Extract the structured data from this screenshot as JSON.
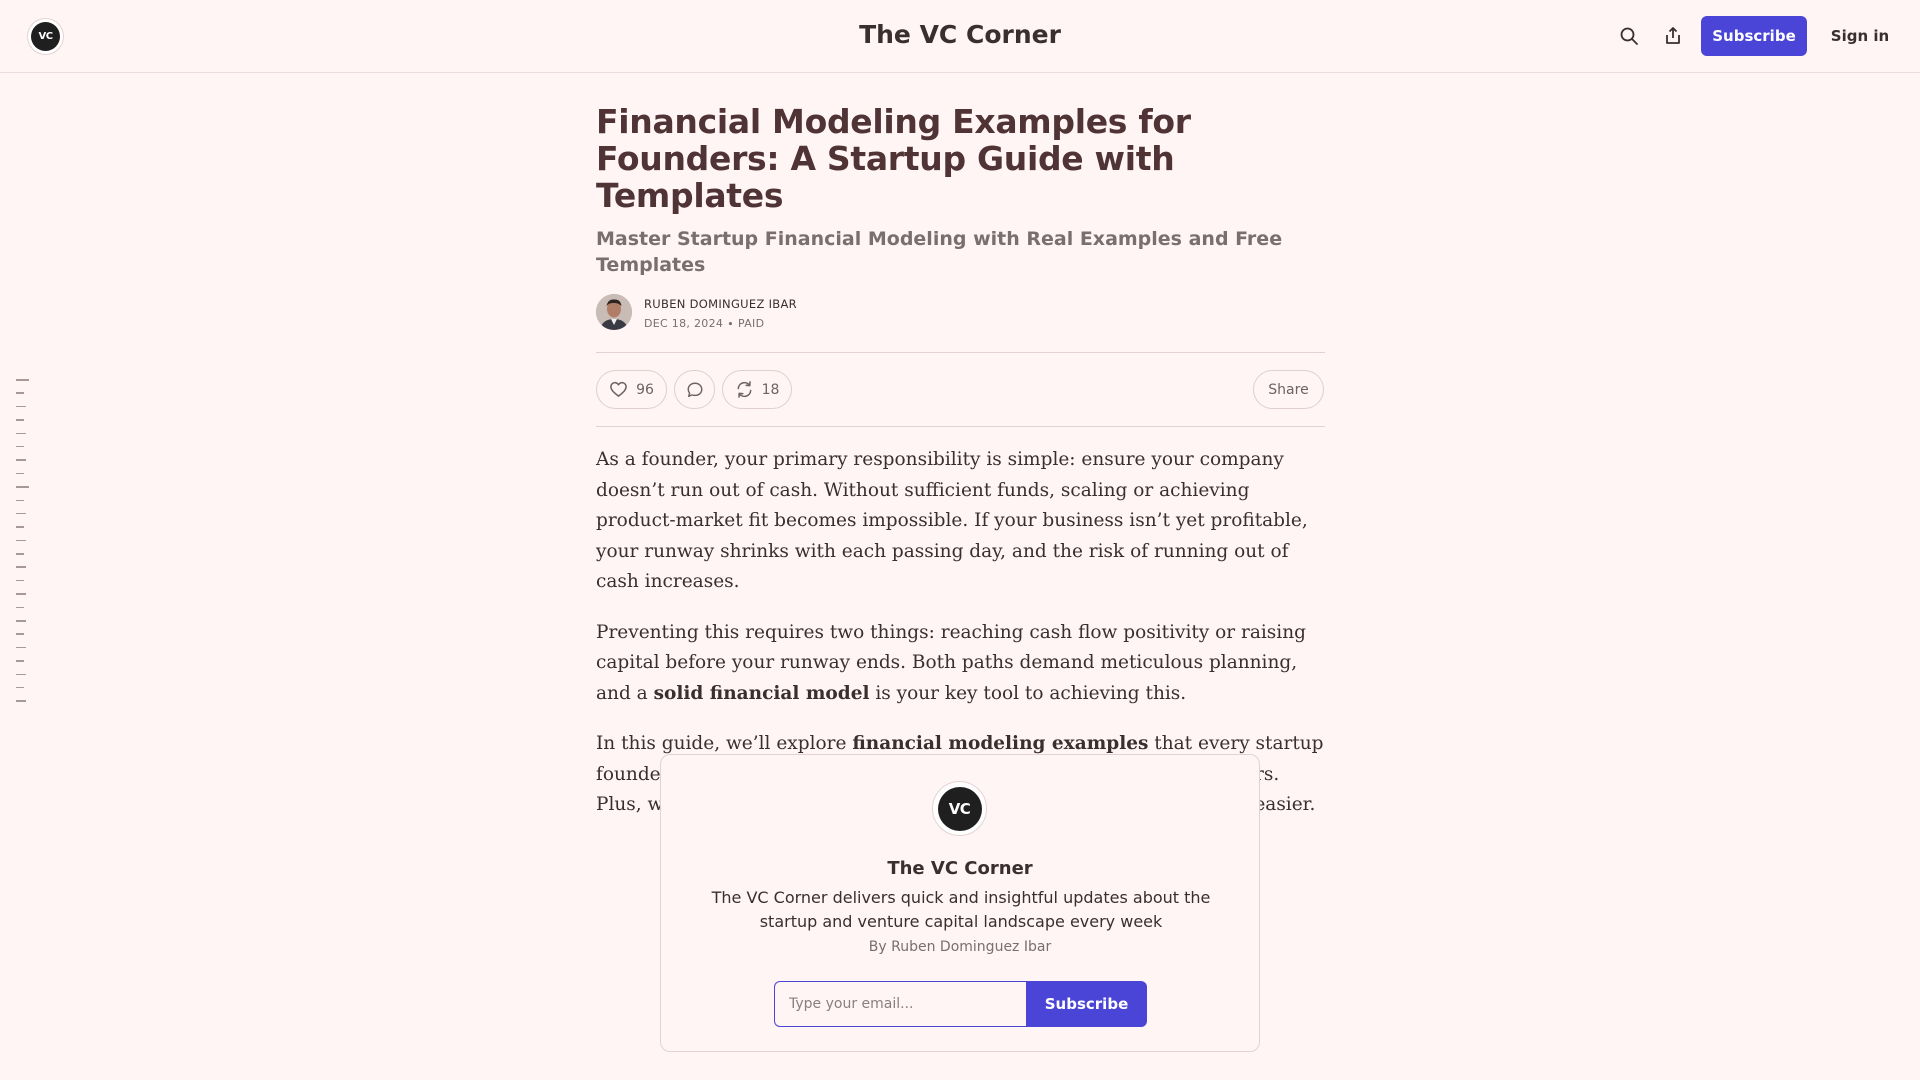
{
  "header": {
    "logo_text": "VC",
    "site_title": "The VC Corner",
    "subscribe_label": "Subscribe",
    "signin_label": "Sign in",
    "icons": [
      "search-icon",
      "share-icon"
    ]
  },
  "post": {
    "title": "Financial Modeling Examples for Founders: A Startup Guide with Templates",
    "subtitle": "Master Startup Financial Modeling with Real Examples and Free Templates",
    "author": "RUBEN DOMINGUEZ IBAR",
    "date": "DEC 18, 2024",
    "separator": "∙",
    "access": "PAID",
    "likes": "96",
    "restacks": "18",
    "share_label": "Share",
    "paragraphs": [
      {
        "parts": [
          {
            "text": "As a founder, your primary responsibility is simple: ensure your company doesn’t run out of cash. Without sufficient funds, scaling or achieving product-market fit becomes impossible. If your business isn’t yet profitable, your runway shrinks with each passing day, and the risk of running out of cash increases."
          }
        ]
      },
      {
        "parts": [
          {
            "text": "Preventing this requires two things: reaching cash flow positivity or raising capital before your runway ends. Both paths demand meticulous planning, and a "
          },
          {
            "text": "solid financial model",
            "bold": true
          },
          {
            "text": " is your key tool to achieving this."
          }
        ]
      },
      {
        "parts": [
          {
            "text": "In this guide, we’ll explore "
          },
          {
            "text": "financial modeling examples",
            "bold": true
          },
          {
            "text": " that every startup founder should know, covering revenue, cost, and non-operating drivers. Plus, we’ve included templates to make building your financial model easier."
          }
        ]
      }
    ]
  },
  "subscribe_card": {
    "logo_text": "VC",
    "title": "The VC Corner",
    "description": "The VC Corner delivers quick and insightful updates about the startup and venture capital landscape every week",
    "byline": "By Ruben Dominguez Ibar",
    "email_placeholder": "Type your email...",
    "button_label": "Subscribe"
  },
  "colors": {
    "background": "#fff5f4",
    "accent": "#4a45d6",
    "title": "#4f3335",
    "text": "#3a2e2e",
    "muted": "#7a6e6e"
  },
  "toc": {
    "entries": 25
  }
}
